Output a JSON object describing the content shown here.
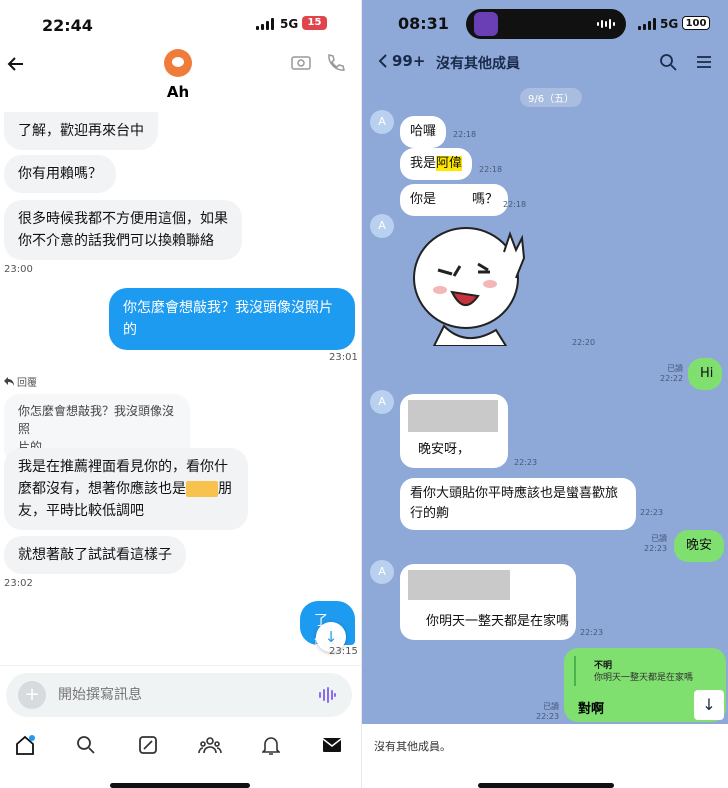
{
  "left": {
    "status": {
      "time": "22:44",
      "network": "5G",
      "battery": "15"
    },
    "header": {
      "back_icon": "arrow-left-icon",
      "name": "Ah",
      "video_icon": "video-icon",
      "call_icon": "phone-icon"
    },
    "messages": {
      "m1": "了解，歡迎再來台中",
      "m2": "你有用賴嗎？",
      "m3": "很多時候我都不方便用這個，如果\n你不介意的話我們可以換賴聯絡",
      "t1": "23:00",
      "m4": "你怎麼會想敲我？我沒頭像沒照片\n的",
      "t2": "23:01",
      "reply_label": "回覆",
      "quote": "你怎麼會想敲我？我沒頭像沒照\n片的",
      "m5a": "我是在推薦裡面看見你的，看你什\n麼都沒有，想著你應該也是",
      "m5b": "朋",
      "m5c": "友，平時比較低調吧",
      "m6": "就想著敲了試試看這樣子",
      "t3": "23:02",
      "m7": "了解",
      "t4": "23:15"
    },
    "composer": {
      "placeholder": "開始撰寫訊息"
    },
    "nav": [
      "home-icon",
      "search-icon",
      "grok-icon",
      "communities-icon",
      "notifications-icon",
      "messages-icon"
    ]
  },
  "right": {
    "status": {
      "time": "08:31",
      "network": "5G",
      "battery": "100"
    },
    "header": {
      "count": "99+",
      "title": "沒有其他成員"
    },
    "date": "9/6（五）",
    "messages": {
      "r1": "哈囉",
      "r1t": "22:18",
      "r2a": "我是",
      "r2b": "阿偉",
      "r2t": "22:18",
      "r3a": "你是",
      "r3b": "嗎？",
      "r3t": "22:18",
      "sticker_t": "22:20",
      "read1": "已讀",
      "s1t": "22:22",
      "s1": "Hi",
      "r4": "晚安呀，",
      "r4t": "22:23",
      "r5": "看你大頭貼你平時應該也是蠻喜歡旅\n行的齁",
      "r5t": "22:23",
      "read2": "已讀",
      "s2t": "22:23",
      "s2": "晚安",
      "r6": "你明天一整天都是在家嗎",
      "r6t": "22:23",
      "read3": "已讀",
      "s3t": "22:23",
      "s3_quote_name": "不明",
      "s3_quote": "你明天一整天都是在家嗎",
      "s3": "對啊"
    },
    "footer": "沒有其他成員。"
  }
}
